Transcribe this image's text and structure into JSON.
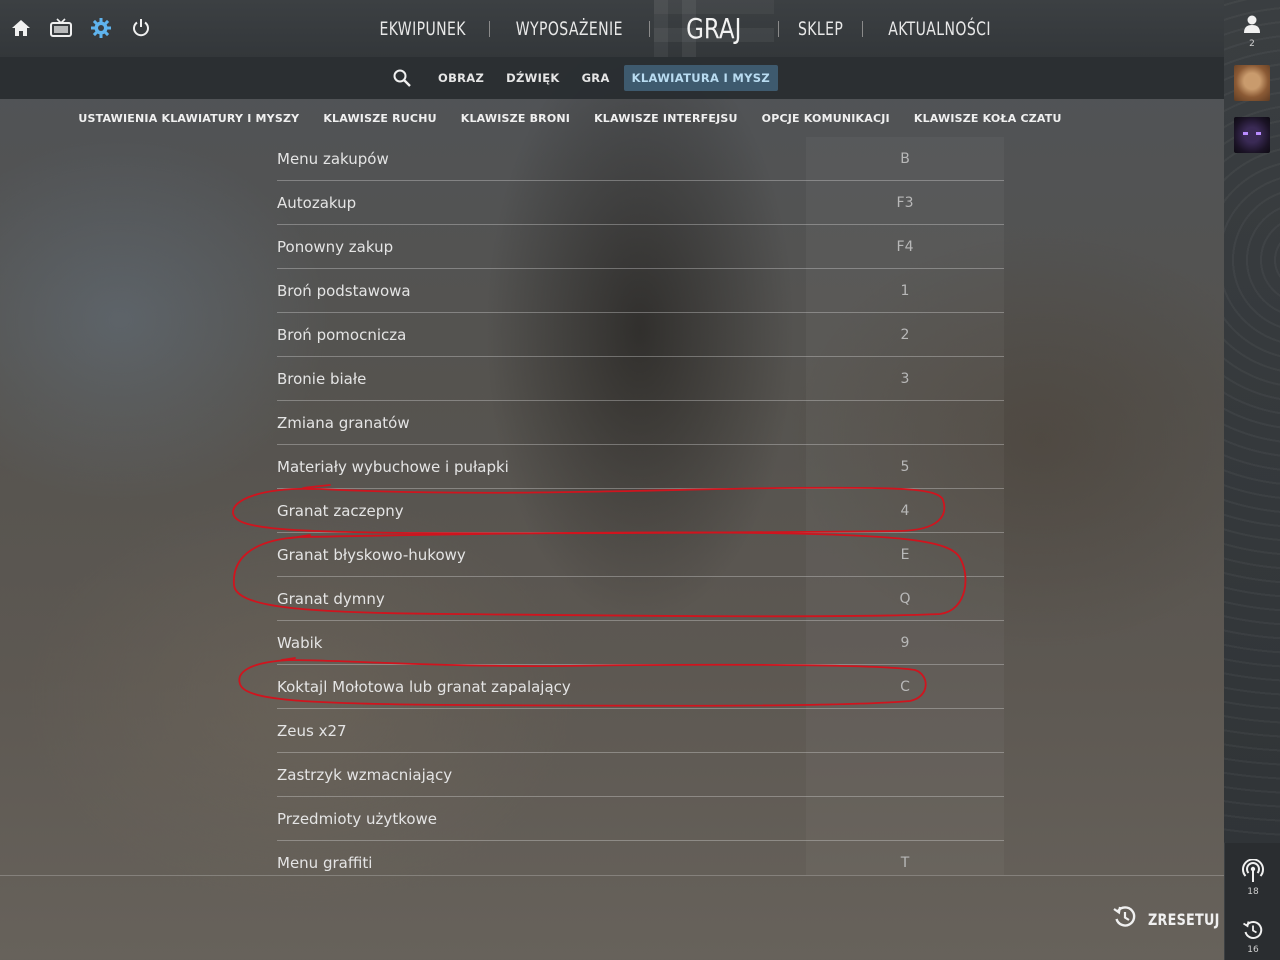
{
  "left_icons": [
    "home-icon",
    "tv-icon",
    "settings-gear-icon",
    "power-icon"
  ],
  "main_nav": {
    "items": [
      "EKWIPUNEK",
      "WYPOSAŻENIE",
      "GRAJ",
      "SKLEP",
      "AKTUALNOŚCI"
    ]
  },
  "settings_tabs": [
    "OBRAZ",
    "DŹWIĘK",
    "GRA",
    "KLAWIATURA I MYSZ"
  ],
  "settings_active_tab": "KLAWIATURA I MYSZ",
  "categories": [
    "USTAWIENIA KLAWIATURY I MYSZY",
    "KLAWISZE RUCHU",
    "KLAWISZE BRONI",
    "KLAWISZE INTERFEJSU",
    "OPCJE KOMUNIKACJI",
    "KLAWISZE KOŁA CZATU"
  ],
  "bindings": [
    {
      "label": "Menu zakupów",
      "key": "B"
    },
    {
      "label": "Autozakup",
      "key": "F3"
    },
    {
      "label": "Ponowny zakup",
      "key": "F4"
    },
    {
      "label": "Broń podstawowa",
      "key": "1"
    },
    {
      "label": "Broń pomocnicza",
      "key": "2"
    },
    {
      "label": "Bronie białe",
      "key": "3"
    },
    {
      "label": "Zmiana granatów",
      "key": ""
    },
    {
      "label": "Materiały wybuchowe i pułapki",
      "key": "5"
    },
    {
      "label": "Granat zaczepny",
      "key": "4"
    },
    {
      "label": "Granat błyskowo-hukowy",
      "key": "E"
    },
    {
      "label": "Granat dymny",
      "key": "Q"
    },
    {
      "label": "Wabik",
      "key": "9"
    },
    {
      "label": "Koktajl Mołotowa lub granat zapalający",
      "key": "C"
    },
    {
      "label": "Zeus x27",
      "key": ""
    },
    {
      "label": "Zastrzyk wzmacniający",
      "key": ""
    },
    {
      "label": "Przedmioty użytkowe",
      "key": ""
    },
    {
      "label": "Menu graffiti",
      "key": "T"
    }
  ],
  "reset_label": "ZRESETUJ",
  "sidebar": {
    "friends_count": "2",
    "signal_count": "18",
    "history_count": "16"
  },
  "annotation_color": "#d0141e",
  "accent_color": "#b9dcf1"
}
